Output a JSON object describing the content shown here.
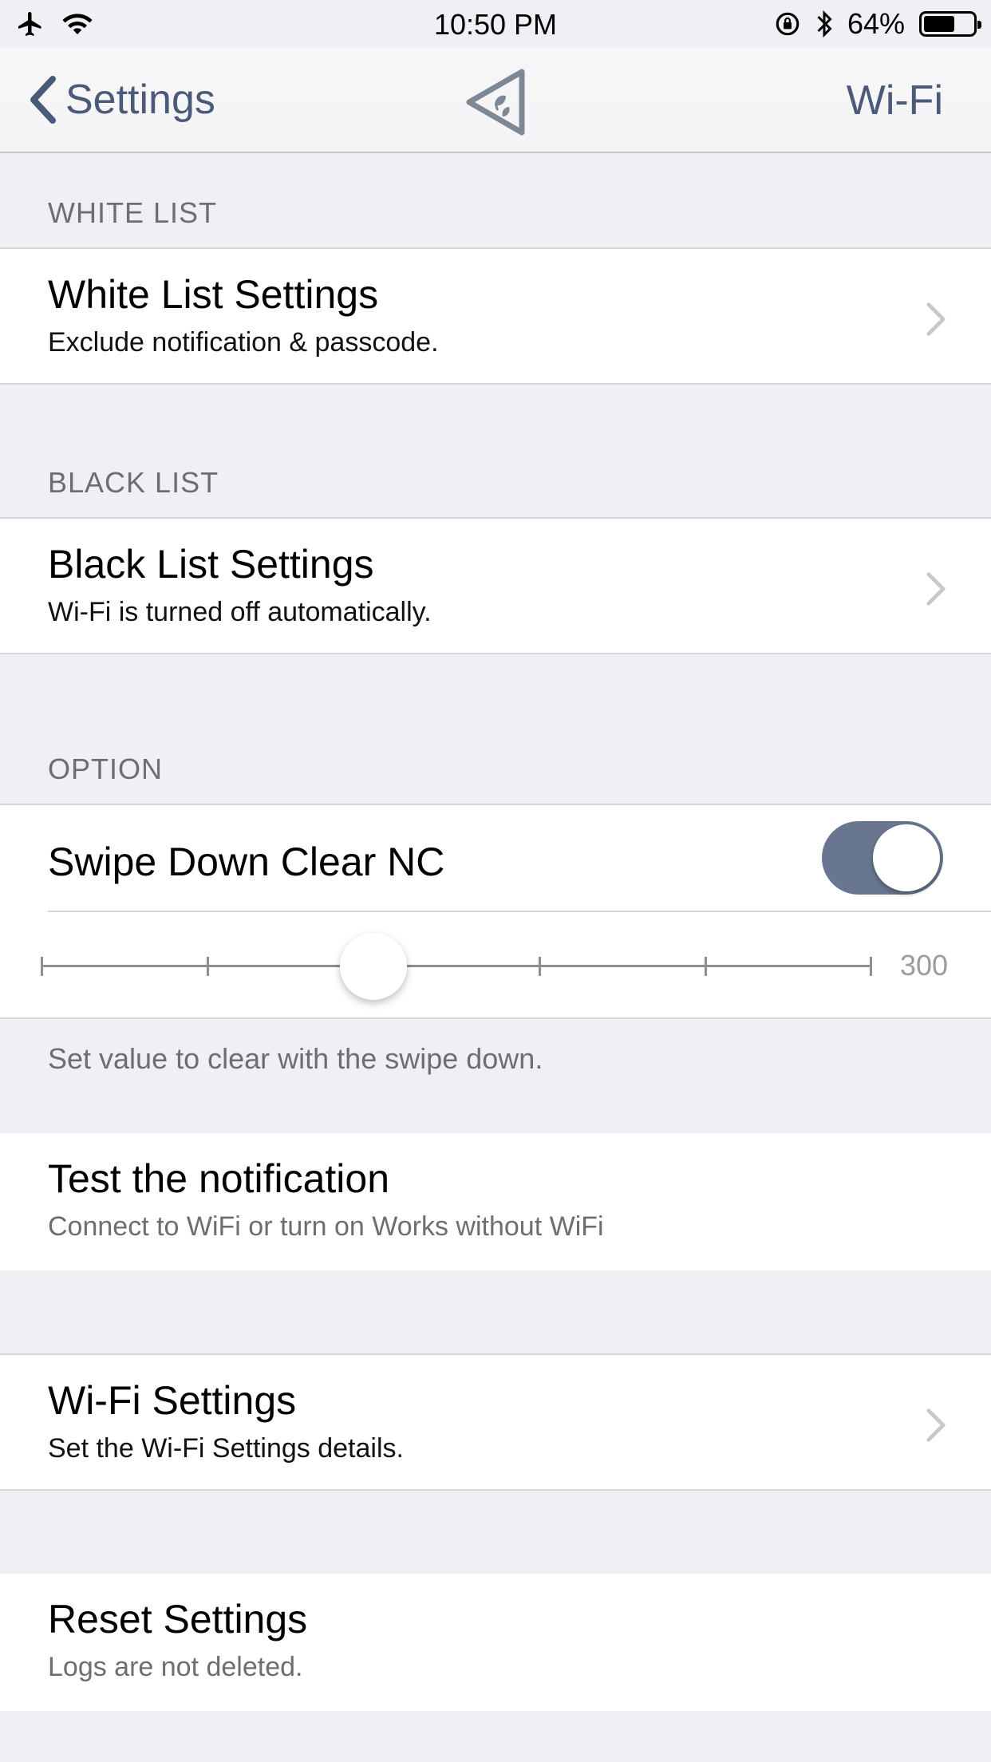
{
  "status_bar": {
    "time": "10:50 PM",
    "battery_percent": "64%",
    "battery_level": 0.64,
    "icons": [
      "airplane-icon",
      "wifi-icon",
      "orientation-lock-icon",
      "bluetooth-icon",
      "battery-icon"
    ]
  },
  "nav": {
    "back_label": "Settings",
    "right_label": "Wi-Fi",
    "accent_color": "#4a5a78"
  },
  "sections": {
    "white_list": {
      "header": "WHITE LIST",
      "title": "White List Settings",
      "subtitle": "Exclude notification & passcode."
    },
    "black_list": {
      "header": "BLACK LIST",
      "title": "Black List Settings",
      "subtitle": "Wi-Fi is turned off automatically."
    },
    "option": {
      "header": "OPTION",
      "toggle_label": "Swipe Down Clear NC",
      "toggle_on": true,
      "slider_value": "300",
      "slider_fraction": 0.4,
      "footer": "Set value to clear with the swipe down."
    },
    "test": {
      "title": "Test the notification",
      "subtitle": "Connect to WiFi or turn on Works without WiFi"
    },
    "wifi": {
      "title": "Wi-Fi Settings",
      "subtitle": "Set the Wi-Fi Settings details."
    },
    "reset": {
      "title": "Reset Settings",
      "subtitle": "Logs are not deleted."
    }
  },
  "colors": {
    "toggle_on": "#68768f",
    "background": "#efeff4",
    "secondary_text": "#6d6d72"
  }
}
